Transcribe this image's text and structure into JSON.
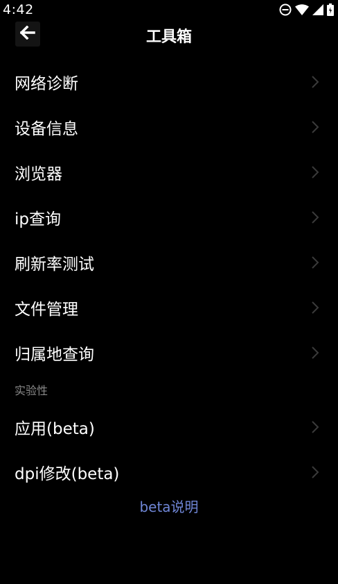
{
  "status_bar": {
    "time": "4:42"
  },
  "toolbar": {
    "title": "工具箱"
  },
  "menu": {
    "items": [
      {
        "label": "网络诊断"
      },
      {
        "label": "设备信息"
      },
      {
        "label": "浏览器"
      },
      {
        "label": "ip查询"
      },
      {
        "label": "刷新率测试"
      },
      {
        "label": "文件管理"
      },
      {
        "label": "归属地查询"
      }
    ]
  },
  "experimental": {
    "header": "实验性",
    "items": [
      {
        "label": "应用(beta)"
      },
      {
        "label": "dpi修改(beta)"
      }
    ]
  },
  "beta_link": "beta说明",
  "colors": {
    "background": "#000000",
    "text": "#ffffff",
    "section_header": "#8a8a8a",
    "link": "#6f86d6",
    "chevron": "#3a3a3a"
  },
  "icons": [
    "do-not-disturb-icon",
    "wifi-icon",
    "signal-icon",
    "battery-icon",
    "back-arrow-icon",
    "chevron-right-icon"
  ]
}
